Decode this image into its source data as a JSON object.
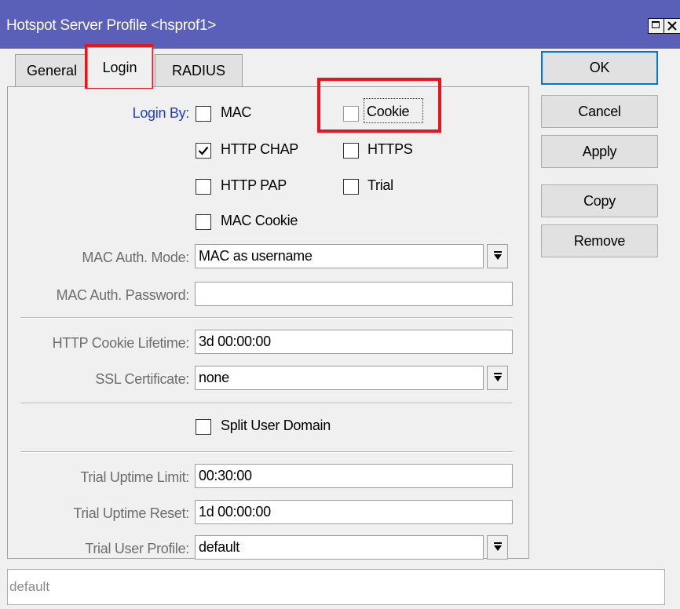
{
  "window": {
    "title": "Hotspot Server Profile <hsprof1>"
  },
  "tabs": [
    {
      "label": "General"
    },
    {
      "label": "Login",
      "active": true
    },
    {
      "label": "RADIUS"
    }
  ],
  "login_by": {
    "label": "Login By:",
    "options": [
      {
        "label": "MAC",
        "checked": false
      },
      {
        "label": "Cookie",
        "checked": false
      },
      {
        "label": "HTTP CHAP",
        "checked": true
      },
      {
        "label": "HTTPS",
        "checked": false
      },
      {
        "label": "HTTP PAP",
        "checked": false
      },
      {
        "label": "Trial",
        "checked": false
      },
      {
        "label": "MAC Cookie",
        "checked": false
      }
    ]
  },
  "fields": {
    "mac_auth_mode": {
      "label": "MAC Auth. Mode:",
      "value": "MAC as username"
    },
    "mac_auth_password": {
      "label": "MAC Auth. Password:",
      "value": ""
    },
    "http_cookie_lifetime": {
      "label": "HTTP Cookie Lifetime:",
      "value": "3d 00:00:00"
    },
    "ssl_certificate": {
      "label": "SSL Certificate:",
      "value": "none"
    },
    "trial_uptime_limit": {
      "label": "Trial Uptime Limit:",
      "value": "00:30:00"
    },
    "trial_uptime_reset": {
      "label": "Trial Uptime Reset:",
      "value": "1d 00:00:00"
    },
    "trial_user_profile": {
      "label": "Trial User Profile:",
      "value": "default"
    }
  },
  "split_user_domain": {
    "label": "Split User Domain",
    "checked": false
  },
  "buttons": {
    "ok": "OK",
    "cancel": "Cancel",
    "apply": "Apply",
    "copy": "Copy",
    "remove": "Remove"
  },
  "status_bar": {
    "text": "default"
  },
  "colors": {
    "titlebar": "#5a5fb7",
    "highlight": "#e8151c",
    "link_label": "#1e3ecf"
  }
}
